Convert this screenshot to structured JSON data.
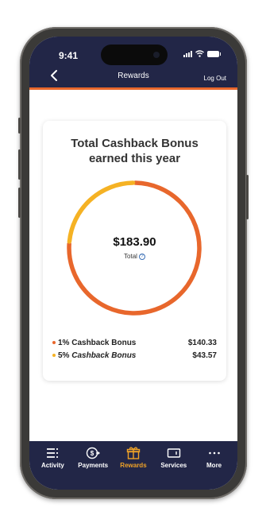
{
  "status": {
    "time": "9:41"
  },
  "header": {
    "title": "Rewards",
    "logout": "Log Out"
  },
  "card": {
    "title_line1": "Total Cashback Bonus",
    "title_line2": "earned this year",
    "total_amount": "$183.90",
    "total_label": "Total",
    "legend": [
      {
        "label": "1% Cashback Bonus",
        "value": "$140.33",
        "color": "#e8672c",
        "fraction": 0.763
      },
      {
        "label_prefix": "5% ",
        "label_italic": "Cashback Bonus",
        "value": "$43.57",
        "color": "#f5b224",
        "fraction": 0.237
      }
    ]
  },
  "tabs": [
    {
      "label": "Activity",
      "icon": "activity-icon",
      "active": false
    },
    {
      "label": "Payments",
      "icon": "payments-icon",
      "active": false
    },
    {
      "label": "Rewards",
      "icon": "gift-icon",
      "active": true
    },
    {
      "label": "Services",
      "icon": "card-icon",
      "active": false
    },
    {
      "label": "More",
      "icon": "more-dots-icon",
      "active": false
    }
  ],
  "colors": {
    "navy": "#222647",
    "orange": "#e8672c",
    "yellow": "#f5b224",
    "active_tab": "#f0a327"
  }
}
